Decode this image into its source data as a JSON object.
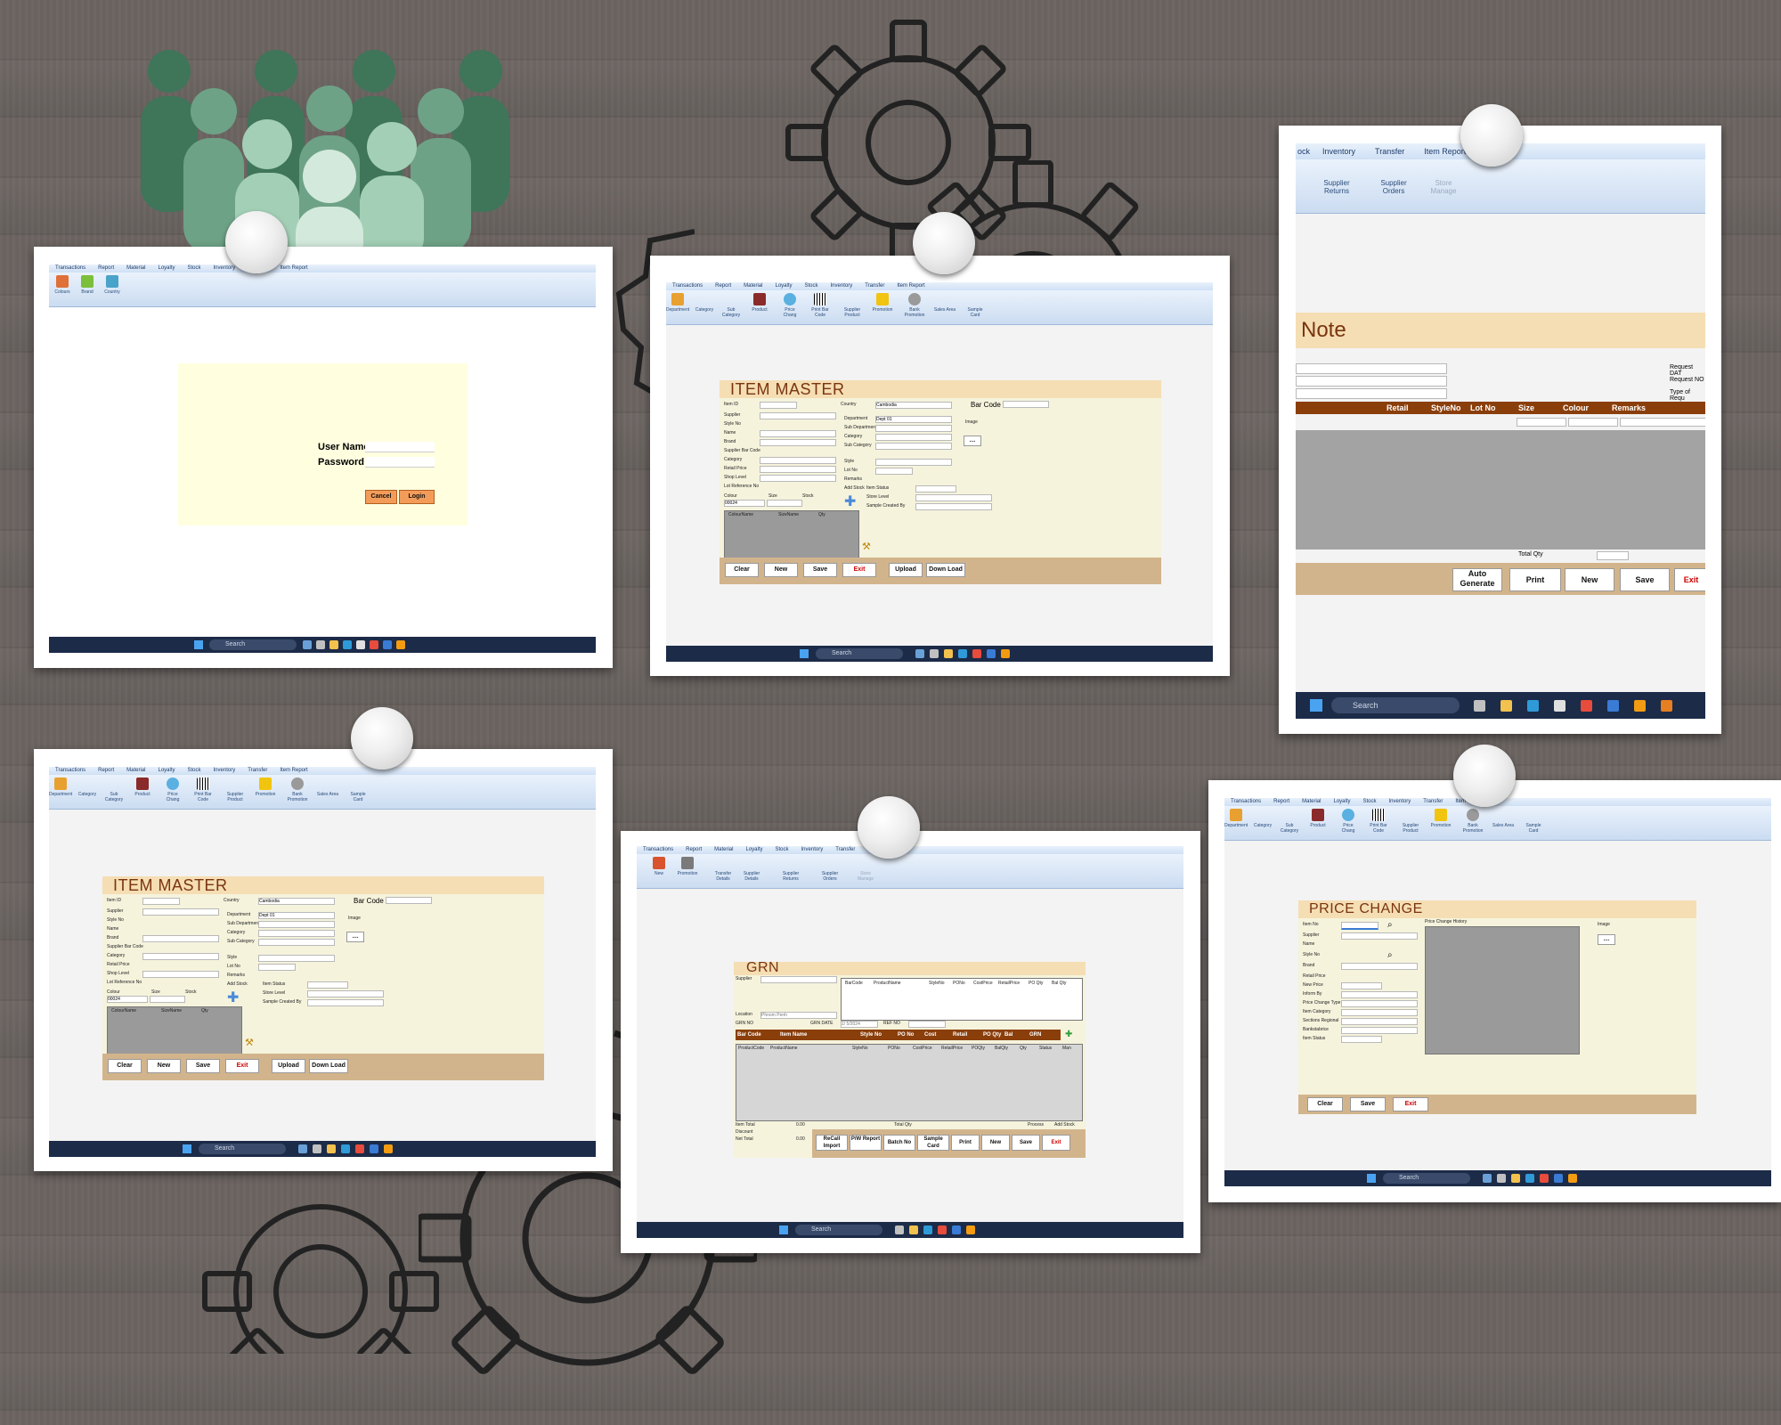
{
  "colors": {
    "accent_brown": "#8a3e0a",
    "form_header": "#f5deb3",
    "form_body": "#f5f3dc",
    "footer_tan": "#d2b48c",
    "ribbon_blue": "#cfe0f5"
  },
  "icons": [
    "gear-icon",
    "people-icon",
    "pushpin-icon",
    "windows-start-icon",
    "search-icon"
  ],
  "menu": [
    "Transactions",
    "Report",
    "Material",
    "Loyalty",
    "Stock",
    "Inventory",
    "Transfer",
    "Item Report"
  ],
  "ribbon": {
    "login": [
      "Colours",
      "Brand",
      "Country"
    ],
    "master": [
      "Department",
      "Category",
      "Sub Category",
      "Product",
      "Price Chang",
      "Print Bar Code",
      "Supplier Product",
      "Promotion",
      "Bank Promotion",
      "Sales Area",
      "Sample Card"
    ],
    "grn": [
      "New",
      "Promotion",
      "Transfer Details",
      "Supplier Details",
      "Supplier Returns",
      "Supplier Orders",
      "Store Manage"
    ],
    "note": [
      "Supplier Returns",
      "Supplier Orders",
      "Store Manage"
    ]
  },
  "taskbar": {
    "search": "Search"
  },
  "login": {
    "username_label": "User Name",
    "password_label": "Password",
    "cancel": "Cancel",
    "login": "Login"
  },
  "item_master": {
    "title": "ITEM MASTER",
    "barcode_label": "Bar Code",
    "image_label": "Image",
    "left_labels": [
      "Item ID",
      "Supplier",
      "Style No",
      "Name",
      "Brand",
      "Supplier Bar Code",
      "Category",
      "Retail Price",
      "Shop Level",
      "Lot Reference No"
    ],
    "right_labels": [
      "Country",
      "Category",
      "Department",
      "Sub Department",
      "Category",
      "Sub Category",
      "Style",
      "Lot No",
      "Remarks",
      "Item Status",
      "Store Level",
      "Sample Created By"
    ],
    "country_value": "Cambodia",
    "department_value": "Dept 01",
    "add_stock": "Add Stock",
    "colour_label": "Colour",
    "size_label": "Size",
    "stock_label": "Stock",
    "colour_value": "00024",
    "grid_headers": [
      "ColourName",
      "SizeName",
      "Qty"
    ],
    "buttons": [
      "Clear",
      "New",
      "Save",
      "Exit",
      "Upload",
      "Down Load"
    ]
  },
  "note": {
    "title": "Note",
    "menu": [
      "ock",
      "Inventory",
      "Transfer",
      "Item Report"
    ],
    "right_labels": [
      "Request DAT",
      "Request NO",
      "Type of Requ"
    ],
    "grid_headers": [
      "Retail",
      "StyleNo",
      "Lot No",
      "Size",
      "Colour",
      "Remarks"
    ],
    "total_label": "Total Qty",
    "buttons": [
      "Auto Generate",
      "Print",
      "New",
      "Save",
      "Exit"
    ]
  },
  "grn": {
    "title": "GRN",
    "supplier_label": "Supplier",
    "location_label": "Location",
    "location_value": "Phnom Penh",
    "grn_no_label": "GRN NO",
    "grn_date_label": "GRN DATE",
    "date_value": "1/ 5/2024",
    "ref_label": "REF NO",
    "top_headers": [
      "BarCode",
      "ProductName",
      "StyleNo",
      "PONo",
      "CostPrice",
      "RetailPrice",
      "PO Qty",
      "Bal Qty"
    ],
    "brown_headers": [
      "Bar Code",
      "Item Name",
      "Style No",
      "PO No",
      "Cost",
      "Retail",
      "PO Qty",
      "Bal",
      "GRN"
    ],
    "grid_headers": [
      "ProductCode",
      "ProductName",
      "StyleNo",
      "PONo",
      "CostPrice",
      "RetailPrice",
      "POQty",
      "BalQty",
      "Qty",
      "Status",
      "Man"
    ],
    "item_total_label": "Item Total",
    "discount_label": "Discount",
    "net_total_label": "Net Total",
    "zero": "0.00",
    "total_qty_label": "Total Qty",
    "process": "Process",
    "add_stock": "Add Stock",
    "buttons": [
      "ReCall Import",
      "P/W Report",
      "Batch No",
      "Sample Card",
      "Print",
      "New",
      "Save",
      "Exit"
    ]
  },
  "price_change": {
    "title": "PRICE CHANGE",
    "history_label": "Price Change History",
    "image_label": "Image",
    "labels": [
      "Item No",
      "Supplier",
      "Name",
      "Style No",
      "Brand",
      "Retail Price",
      "New Price",
      "Inform By",
      "Price Change Type",
      "Item Category",
      "Sections Regional",
      "Bankstabrice",
      "Item Status"
    ],
    "buttons": [
      "Clear",
      "Save",
      "Exit"
    ]
  }
}
